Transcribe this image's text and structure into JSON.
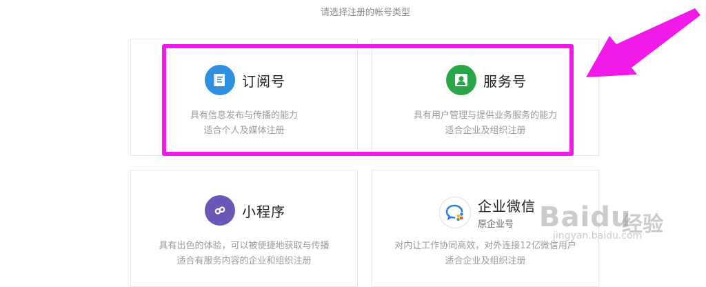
{
  "subtitle": "请选择注册的帐号类型",
  "cards": [
    {
      "icon": "document-icon",
      "icon_color": "#2f8fe0",
      "name": "订阅号",
      "desc": [
        "具有信息发布与传播的能力",
        "适合个人及媒体注册"
      ]
    },
    {
      "icon": "person-icon",
      "icon_color": "#29a647",
      "name": "服务号",
      "desc": [
        "具有用户管理与提供业务服务的能力",
        "适合企业及组织注册"
      ]
    },
    {
      "icon": "mini-program-icon",
      "icon_color": "#6d57b6",
      "name": "小程序",
      "desc": [
        "具有出色的体验，可以被便捷地获取与传播",
        "适合有服务内容的企业和组织注册"
      ]
    },
    {
      "icon": "wecom-icon",
      "icon_color": "#2b7fe0",
      "name": "企业微信",
      "subname": "原企业号",
      "desc": [
        "对内让工作协同高效，对外连接12亿微信用户",
        "适合企业及组织注册"
      ]
    }
  ],
  "annotation": {
    "highlight_color": "#f21ae8"
  },
  "watermark": {
    "logo": "Baidu",
    "cn": "经验",
    "url": "jingyan.baidu.com"
  }
}
